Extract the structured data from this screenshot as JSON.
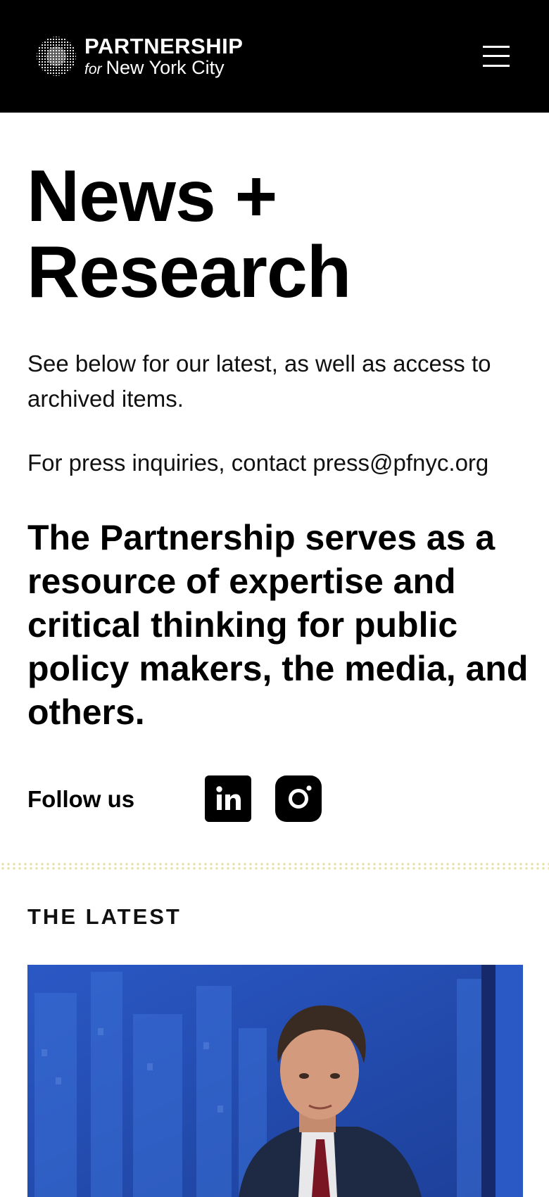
{
  "header": {
    "logo_line1": "PARTNERSHIP",
    "logo_for": "for",
    "logo_line2": "New York City",
    "menu_icon": "hamburger-menu-icon"
  },
  "page": {
    "title_line1": "News +",
    "title_line2": "Research",
    "intro": "See below for our latest, as well as access to archived items.",
    "press_prefix": "For press inquiries, contact",
    "press_email": "press@pfnyc.org",
    "mission": "The Partnership serves as a resource of expertise and critical thinking for public policy makers, the media, and others."
  },
  "social": {
    "label": "Follow us",
    "linkedin_icon": "linkedin-icon",
    "instagram_icon": "instagram-icon"
  },
  "latest": {
    "heading": "THE LATEST"
  },
  "colors": {
    "header_bg": "#000000",
    "page_bg": "#ffffff",
    "divider_dots": "#e6e2a8",
    "card_image_blue": "#2a55b8"
  }
}
